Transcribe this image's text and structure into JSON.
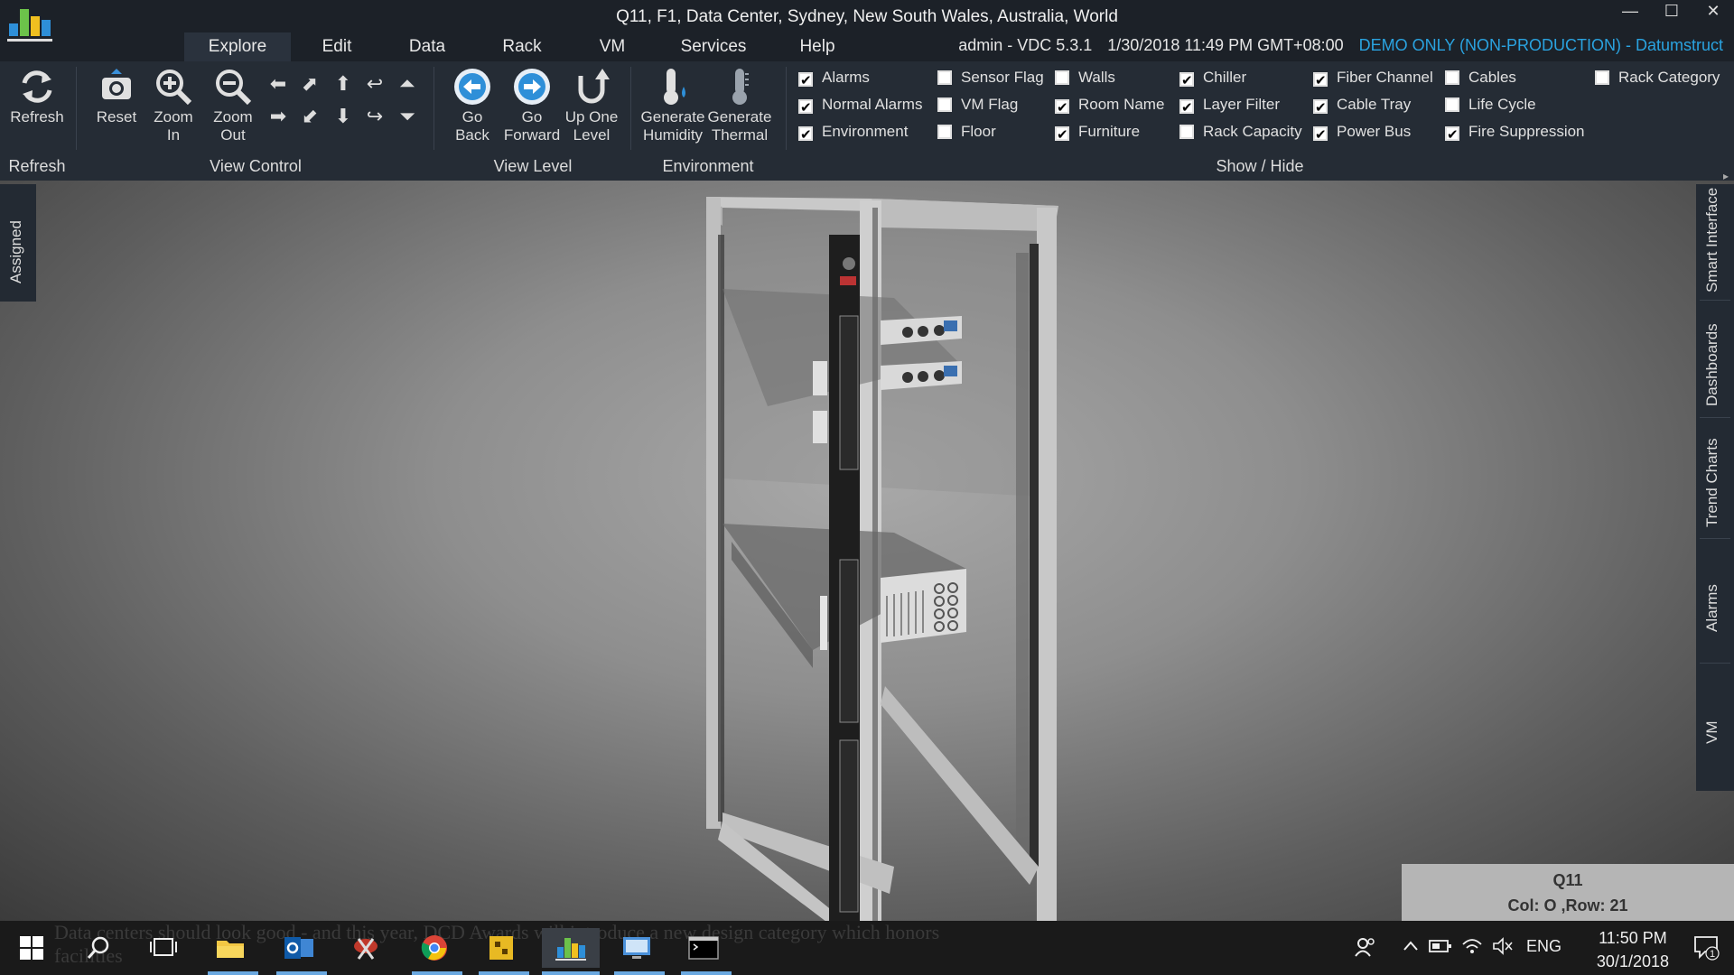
{
  "window": {
    "title": "Q11, F1, Data Center, Sydney, New South Wales, Australia, World",
    "controls": {
      "minimize": "—",
      "maximize": "☐",
      "close": "✕"
    }
  },
  "menu": {
    "tabs": [
      {
        "label": "Explore",
        "active": true
      },
      {
        "label": "Edit"
      },
      {
        "label": "Data"
      },
      {
        "label": "Rack"
      },
      {
        "label": "VM"
      },
      {
        "label": "Services"
      },
      {
        "label": "Help"
      }
    ],
    "user": "admin - VDC 5.3.1",
    "datetime": "1/30/2018 11:49 PM GMT+08:00",
    "demo": "DEMO ONLY (NON-PRODUCTION) - Datumstruct"
  },
  "ribbon": {
    "refresh": {
      "button": "Refresh",
      "group": "Refresh"
    },
    "view_control": {
      "reset": "Reset",
      "zoom_in": [
        "Zoom",
        "In"
      ],
      "zoom_out": [
        "Zoom",
        "Out"
      ],
      "group": "View Control"
    },
    "view_level": {
      "go_back": [
        "Go",
        "Back"
      ],
      "go_forward": [
        "Go",
        "Forward"
      ],
      "up_one": [
        "Up One",
        "Level"
      ],
      "group": "View Level"
    },
    "environment": {
      "humidity": [
        "Generate",
        "Humidity"
      ],
      "thermal": [
        "Generate",
        "Thermal"
      ],
      "group": "Environment"
    },
    "show_hide": {
      "group": "Show / Hide",
      "col1": [
        {
          "label": "Alarms",
          "checked": true
        },
        {
          "label": "Normal Alarms",
          "checked": true
        },
        {
          "label": "Environment",
          "checked": true
        }
      ],
      "col2": [
        {
          "label": "Sensor Flag",
          "checked": false
        },
        {
          "label": "VM Flag",
          "checked": false
        },
        {
          "label": "Floor",
          "checked": false
        }
      ],
      "col3": [
        {
          "label": "Walls",
          "checked": false
        },
        {
          "label": "Room Name",
          "checked": true
        },
        {
          "label": "Furniture",
          "checked": true
        }
      ],
      "col4": [
        {
          "label": "Chiller",
          "checked": true
        },
        {
          "label": "Layer Filter",
          "checked": true
        },
        {
          "label": "Rack Capacity",
          "checked": false
        }
      ],
      "col5": [
        {
          "label": "Fiber Channel",
          "checked": true
        },
        {
          "label": "Cable Tray",
          "checked": true
        },
        {
          "label": "Power Bus",
          "checked": true
        }
      ],
      "col6": [
        {
          "label": "Cables",
          "checked": false
        },
        {
          "label": "Life Cycle",
          "checked": false
        },
        {
          "label": "Fire Suppression",
          "checked": true
        }
      ],
      "col7": [
        {
          "label": "Rack Category",
          "checked": false
        }
      ]
    }
  },
  "side_tabs": {
    "left": "Assigned",
    "right": [
      "Smart Interface",
      "Dashboards",
      "Trend Charts",
      "Alarms",
      "VM"
    ]
  },
  "info": {
    "name": "Q11",
    "position": "Col: O ,Row: 21"
  },
  "taskbar": {
    "language": "ENG",
    "time": "11:50 PM",
    "date": "30/1/2018",
    "notifications": "1",
    "background_text": "Data centers should look good - and this year, DCD Awards will introduce a new design category which honors facilities"
  }
}
